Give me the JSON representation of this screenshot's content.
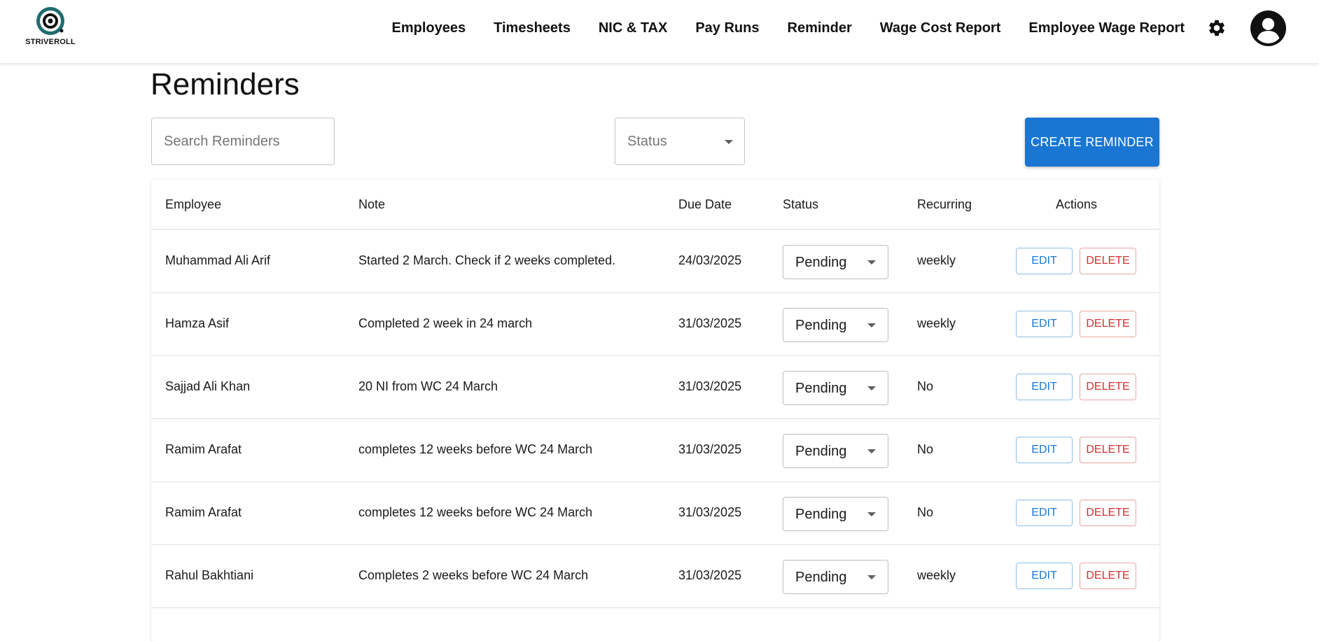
{
  "header": {
    "logo_text": "STRIVEROLL",
    "nav": [
      "Employees",
      "Timesheets",
      "NIC & TAX",
      "Pay Runs",
      "Reminder",
      "Wage Cost Report",
      "Employee Wage Report"
    ],
    "settings_icon": "gear-icon",
    "avatar_icon": "account-circle-icon"
  },
  "page": {
    "title": "Reminders",
    "search_placeholder": "Search Reminders",
    "status_filter_label": "Status",
    "create_button": "CREATE REMINDER"
  },
  "table": {
    "columns": [
      "Employee",
      "Note",
      "Due Date",
      "Status",
      "Recurring",
      "Actions"
    ],
    "rows": [
      {
        "employee": "Muhammad Ali Arif",
        "note": "Started 2 March. Check if 2 weeks completed.",
        "due_date": "24/03/2025",
        "status": "Pending",
        "recurring": "weekly",
        "edit": "EDIT",
        "delete": "DELETE"
      },
      {
        "employee": "Hamza Asif",
        "note": "Completed 2 week in 24 march",
        "due_date": "31/03/2025",
        "status": "Pending",
        "recurring": "weekly",
        "edit": "EDIT",
        "delete": "DELETE"
      },
      {
        "employee": "Sajjad Ali Khan",
        "note": "20 NI from WC 24 March",
        "due_date": "31/03/2025",
        "status": "Pending",
        "recurring": "No",
        "edit": "EDIT",
        "delete": "DELETE"
      },
      {
        "employee": "Ramim Arafat",
        "note": "completes 12 weeks before WC 24 March",
        "due_date": "31/03/2025",
        "status": "Pending",
        "recurring": "No",
        "edit": "EDIT",
        "delete": "DELETE"
      },
      {
        "employee": "Ramim Arafat",
        "note": "completes 12 weeks before WC 24 March",
        "due_date": "31/03/2025",
        "status": "Pending",
        "recurring": "No",
        "edit": "EDIT",
        "delete": "DELETE"
      },
      {
        "employee": "Rahul Bakhtiani",
        "note": "Completes 2 weeks before WC 24 March",
        "due_date": "31/03/2025",
        "status": "Pending",
        "recurring": "weekly",
        "edit": "EDIT",
        "delete": "DELETE"
      }
    ]
  },
  "colors": {
    "primary": "#1976d2",
    "danger": "#d32f2f",
    "logo_teal": "#1f6b6e"
  }
}
